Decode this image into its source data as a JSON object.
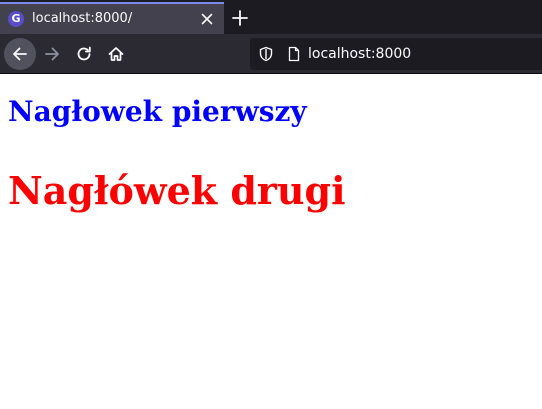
{
  "tab": {
    "title": "localhost:8000/",
    "favicon_letter": "G",
    "icon": "gatsby-favicon-icon"
  },
  "toolbar": {
    "back_icon": "arrow-left-icon",
    "forward_icon": "arrow-right-icon",
    "reload_icon": "reload-icon",
    "home_icon": "home-icon",
    "new_tab_icon": "plus-icon",
    "close_tab_icon": "close-icon"
  },
  "urlbar": {
    "url": "localhost:8000",
    "shield_icon": "shield-icon",
    "page_icon": "page-icon"
  },
  "page": {
    "heading_1": "Nagłowek pierwszy",
    "heading_2": "Nagłówek drugi",
    "heading_1_color": "#0000ff",
    "heading_2_color": "#ff0000"
  },
  "colors": {
    "tabstrip_bg": "#1c1b22",
    "active_tab_bg": "#42414d",
    "active_tab_accent": "#7b8ae8",
    "toolbar_bg": "#2b2a33",
    "urlbar_bg": "#1c1b22"
  }
}
